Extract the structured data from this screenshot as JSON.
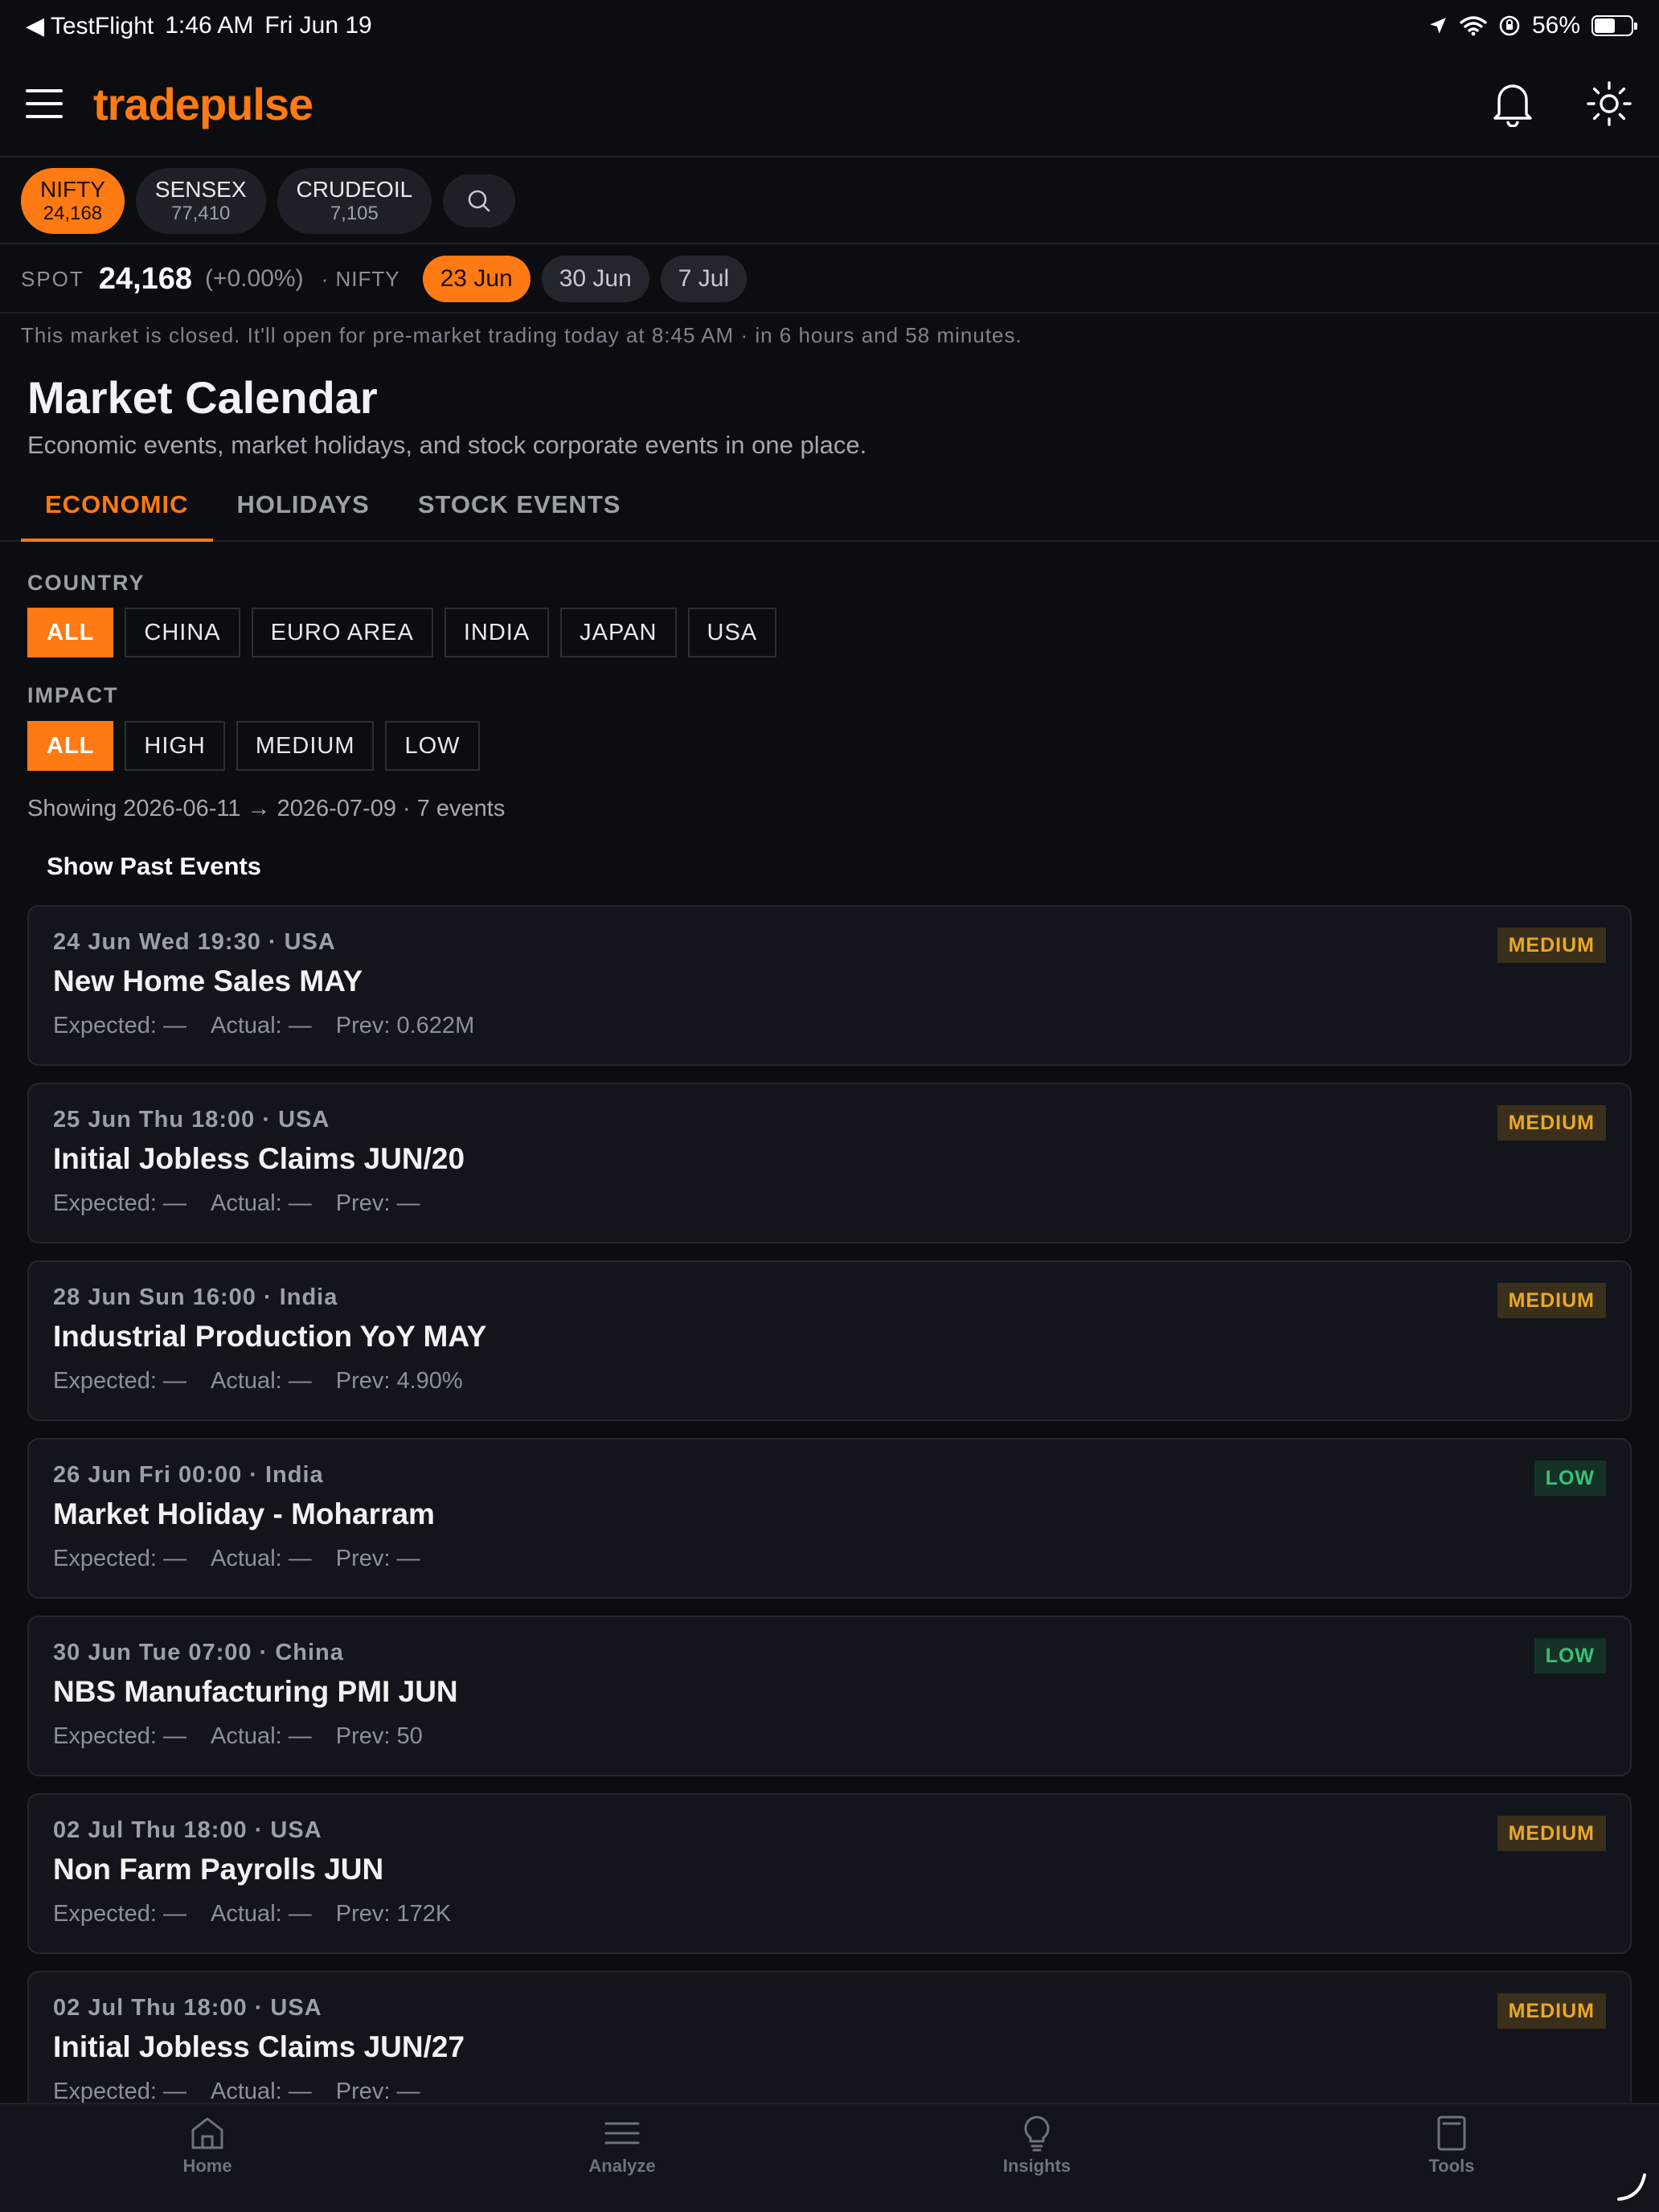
{
  "status_bar": {
    "back_app": "◀ TestFlight",
    "time": "1:46 AM",
    "date": "Fri Jun 19",
    "battery": "56%",
    "battery_level": 0.56
  },
  "header": {
    "logo": "tradepulse",
    "icons": [
      "menu-icon",
      "bell-icon",
      "sun-icon"
    ]
  },
  "tickers": [
    {
      "name": "NIFTY",
      "value": "24,168",
      "active": true
    },
    {
      "name": "SENSEX",
      "value": "77,410",
      "active": false
    },
    {
      "name": "CRUDEOIL",
      "value": "7,105",
      "active": false
    }
  ],
  "spot": {
    "label": "SPOT",
    "value": "24,168",
    "change": "(+0.00%)",
    "index": "· NIFTY",
    "expiries": [
      {
        "label": "23 Jun",
        "active": true
      },
      {
        "label": "30 Jun",
        "active": false
      },
      {
        "label": "7 Jul",
        "active": false
      }
    ]
  },
  "market_note": "This market is closed. It'll open for pre-market trading today at 8:45 AM · in 6 hours and 58 minutes.",
  "page": {
    "title": "Market Calendar",
    "subtitle": "Economic events, market holidays, and stock corporate events in one place."
  },
  "tabs": [
    {
      "label": "ECONOMIC",
      "active": true
    },
    {
      "label": "HOLIDAYS",
      "active": false
    },
    {
      "label": "STOCK EVENTS",
      "active": false
    }
  ],
  "filters": {
    "country_label": "COUNTRY",
    "countries": [
      {
        "label": "ALL",
        "active": true
      },
      {
        "label": "CHINA",
        "active": false
      },
      {
        "label": "EURO AREA",
        "active": false
      },
      {
        "label": "INDIA",
        "active": false
      },
      {
        "label": "JAPAN",
        "active": false
      },
      {
        "label": "USA",
        "active": false
      }
    ],
    "impact_label": "IMPACT",
    "impacts": [
      {
        "label": "ALL",
        "active": true
      },
      {
        "label": "HIGH",
        "active": false
      },
      {
        "label": "MEDIUM",
        "active": false
      },
      {
        "label": "LOW",
        "active": false
      }
    ]
  },
  "showing": "Showing 2026-06-11 → 2026-07-09 · 7 events",
  "show_past_label": "Show Past Events",
  "events": [
    {
      "meta": "24 Jun Wed 19:30 · USA",
      "title": "New Home Sales MAY",
      "expected": "Expected: —",
      "actual": "Actual: —",
      "prev": "Prev: 0.622M",
      "impact": "MEDIUM"
    },
    {
      "meta": "25 Jun Thu 18:00 · USA",
      "title": "Initial Jobless Claims JUN/20",
      "expected": "Expected: —",
      "actual": "Actual: —",
      "prev": "Prev: —",
      "impact": "MEDIUM"
    },
    {
      "meta": "28 Jun Sun 16:00 · India",
      "title": "Industrial Production YoY MAY",
      "expected": "Expected: —",
      "actual": "Actual: —",
      "prev": "Prev: 4.90%",
      "impact": "MEDIUM"
    },
    {
      "meta": "26 Jun Fri 00:00 · India",
      "title": "Market Holiday - Moharram",
      "expected": "Expected: —",
      "actual": "Actual: —",
      "prev": "Prev: —",
      "impact": "LOW"
    },
    {
      "meta": "30 Jun Tue 07:00 · China",
      "title": "NBS Manufacturing PMI JUN",
      "expected": "Expected: —",
      "actual": "Actual: —",
      "prev": "Prev: 50",
      "impact": "LOW"
    },
    {
      "meta": "02 Jul Thu 18:00 · USA",
      "title": "Non Farm Payrolls JUN",
      "expected": "Expected: —",
      "actual": "Actual: —",
      "prev": "Prev: 172K",
      "impact": "MEDIUM"
    },
    {
      "meta": "02 Jul Thu 18:00 · USA",
      "title": "Initial Jobless Claims JUN/27",
      "expected": "Expected: —",
      "actual": "Actual: —",
      "prev": "Prev: —",
      "impact": "MEDIUM"
    }
  ],
  "bottom_nav": [
    {
      "label": "Home",
      "icon": "home-icon"
    },
    {
      "label": "Analyze",
      "icon": "menu-lines-icon"
    },
    {
      "label": "Insights",
      "icon": "lightbulb-icon"
    },
    {
      "label": "Tools",
      "icon": "book-icon"
    }
  ],
  "colors": {
    "accent": "#ff7a12",
    "background": "#0b0d11",
    "card": "#12151b",
    "medium_badge": "#e9a82a",
    "low_badge": "#38c07a"
  }
}
